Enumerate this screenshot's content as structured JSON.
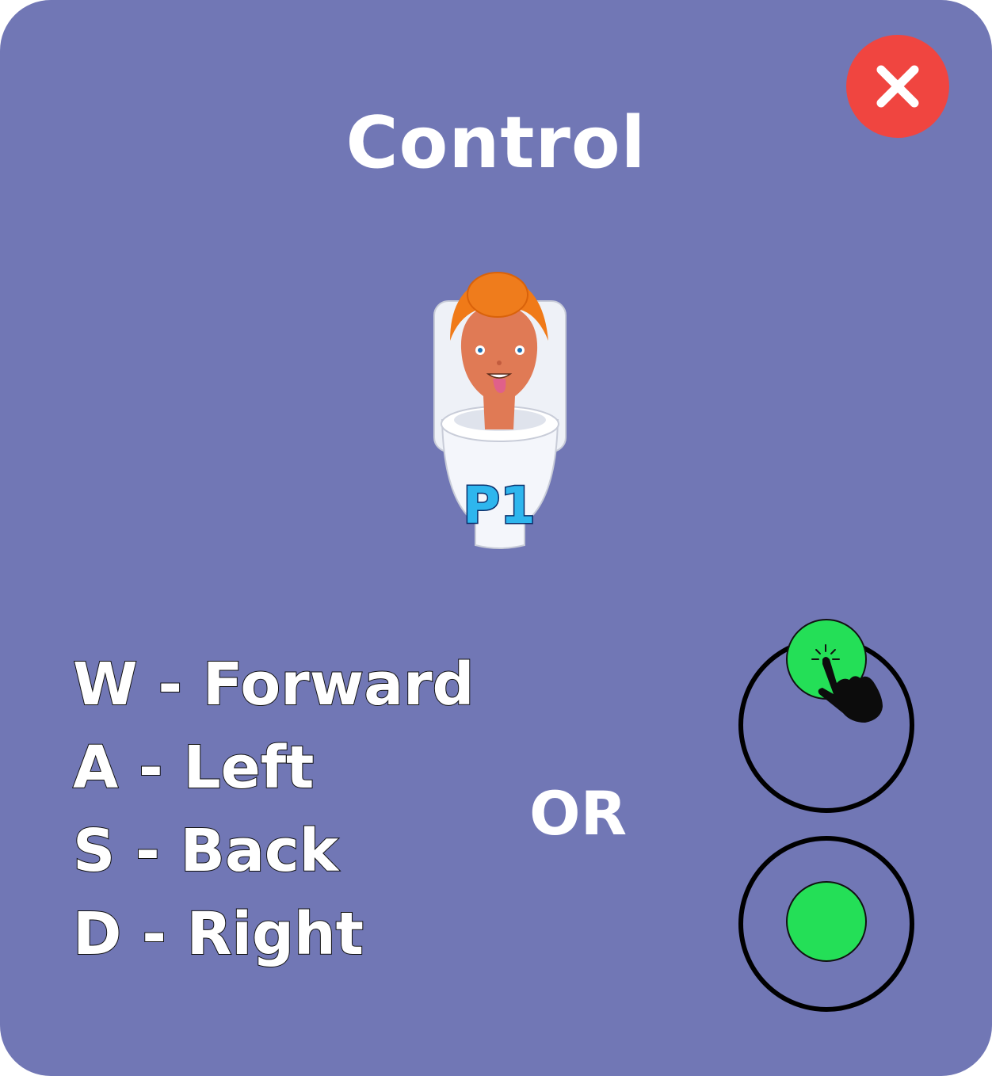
{
  "dialog": {
    "title": "Control",
    "close_icon": "close-x-icon",
    "close_color": "#f04540",
    "background_color": "#7177b5"
  },
  "character": {
    "label": "P1"
  },
  "keyboard_controls": [
    {
      "text": "W - Forward"
    },
    {
      "text": "A - Left"
    },
    {
      "text": "S - Back"
    },
    {
      "text": "D - Right"
    }
  ],
  "separator": "OR",
  "joystick": {
    "knob_color": "#24df57",
    "pointer_icon": "tap-hand-icon"
  }
}
